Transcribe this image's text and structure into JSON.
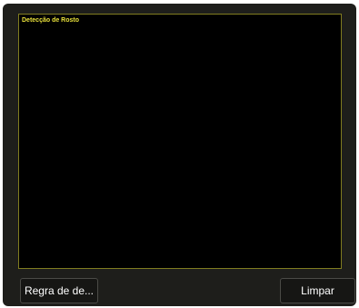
{
  "preview": {
    "title": "Detecção de Rosto"
  },
  "buttons": {
    "rule_label": "Regra de de...",
    "clear_label": "Limpar"
  },
  "colors": {
    "panel_background": "#1e1e1b",
    "preview_background": "#000000",
    "preview_border": "#807c20",
    "title_text": "#e8e03a"
  }
}
